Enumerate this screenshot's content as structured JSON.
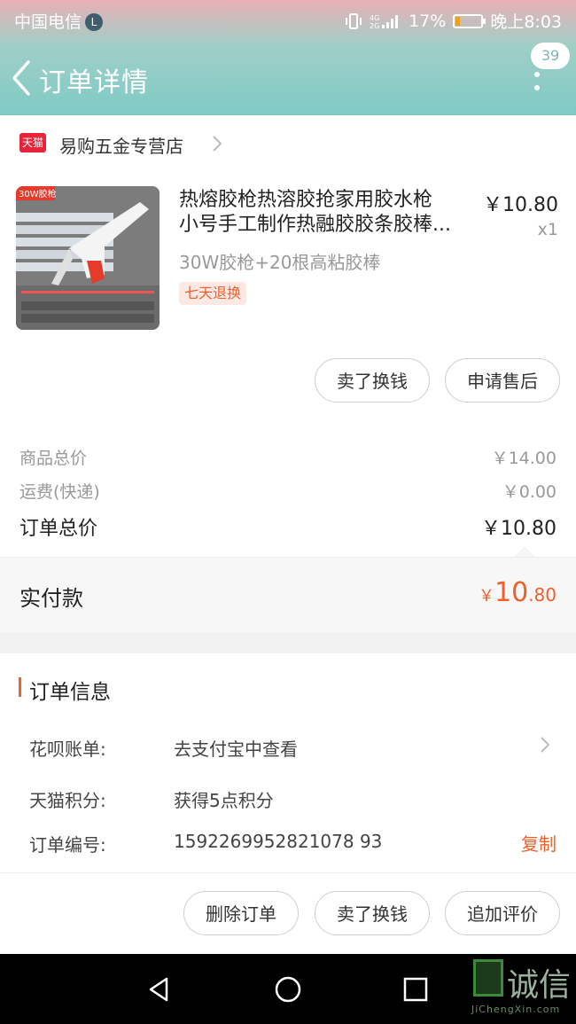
{
  "status_bar": {
    "carrier": "中国电信",
    "battery": "17%",
    "time": "晚上8:03"
  },
  "header": {
    "title": "订单详情",
    "message_badge": "39"
  },
  "shop": {
    "name": "易购五金专营店",
    "platform_badge": "天猫"
  },
  "product": {
    "image_label": "30W胶枪",
    "title_line1": "热熔胶枪热溶胶抢家用胶水枪",
    "title_line2": "小号手工制作热融胶胶条胶棒...",
    "price": "￥10.80",
    "quantity": "x1",
    "sku": "30W胶枪+20根高粘胶棒",
    "tag": "七天退换"
  },
  "item_actions": {
    "sell": "卖了换钱",
    "after_sale": "申请售后"
  },
  "summary": {
    "goods_total_label": "商品总价",
    "goods_total_value": "￥14.00",
    "shipping_label": "运费(快递)",
    "shipping_value": "￥0.00",
    "order_total_label": "订单总价",
    "order_total_value": "￥10.80",
    "paid_label": "实付款",
    "paid_currency": "￥",
    "paid_integer": "10",
    "paid_decimal": ".80"
  },
  "order_info": {
    "title": "订单信息",
    "huabei_label": "花呗账单:",
    "huabei_value": "去支付宝中查看",
    "points_label": "天猫积分:",
    "points_value": "获得5点积分",
    "order_no_label": "订单编号:",
    "order_no_value": "1592269952821078 93",
    "copy": "复制"
  },
  "bottom_actions": {
    "delete": "删除订单",
    "sell": "卖了换钱",
    "add_review": "追加评价"
  },
  "watermark": {
    "text": "诚信",
    "sub": "JiChengXin.com"
  },
  "colors": {
    "accent": "#f0602a",
    "header_teal": "#7fcac6",
    "tmall_red": "#e8233a"
  }
}
